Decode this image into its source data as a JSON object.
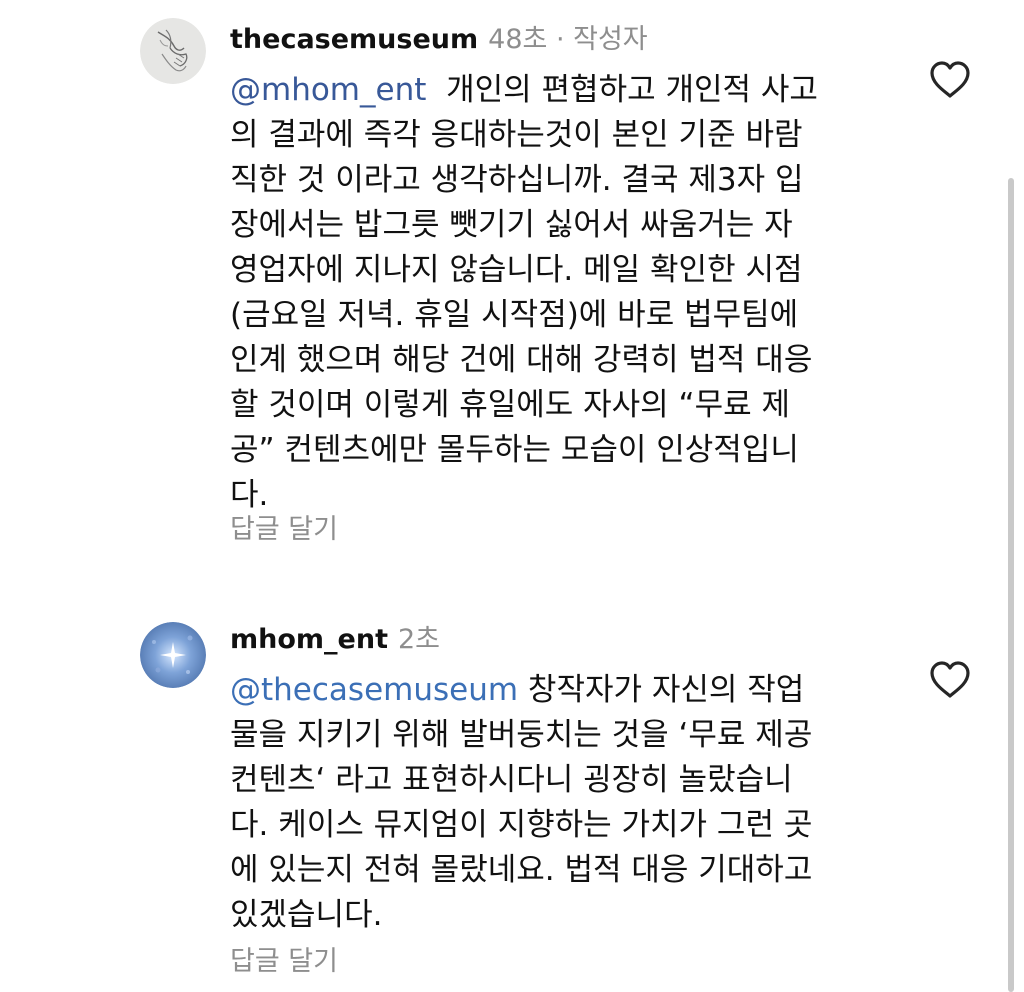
{
  "comments": [
    {
      "username": "thecasemuseum",
      "time": "48초",
      "author_tag": " · 작성자",
      "mention": "@mhom_ent",
      "lines": [
        "개인의 편협하고 개인적 사고",
        "의 결과에 즉각 응대하는것이 본인 기준 바람",
        "직한 것 이라고 생각하십니까. 결국 제3자 입",
        "장에서는 밥그릇 뺏기기 싫어서 싸움거는 자",
        "영업자에 지나지 않습니다. 메일 확인한 시점",
        "(금요일 저녁. 휴일 시작점)에 바로 법무팀에",
        "인계 했으며 해당 건에 대해 강력히 법적 대응",
        "할 것이며 이렇게 휴일에도 자사의 “무료 제",
        "공” 컨텐츠에만 몰두하는 모습이 인상적입니",
        "다."
      ],
      "reply_label": "답글 달기",
      "like_icon": "heart-outline-icon"
    },
    {
      "username": "mhom_ent",
      "time": "2초",
      "mention": "@thecasemuseum",
      "lines": [
        "창작자가 자신의 작업",
        "물을 지키기 위해 발버둥치는 것을 ‘무료 제공",
        "컨텐츠‘ 라고 표현하시다니 굉장히 놀랐습니",
        "다. 케이스 뮤지엄이 지향하는 가치가 그런 곳",
        "에 있는지 전혀 몰랐네요. 법적 대응 기대하고",
        "있겠습니다."
      ],
      "reply_label": "답글 달기",
      "like_icon": "heart-outline-icon"
    }
  ],
  "colors": {
    "mention": "#3b6fb6",
    "muted": "#8e8e8e",
    "text": "#111111"
  }
}
